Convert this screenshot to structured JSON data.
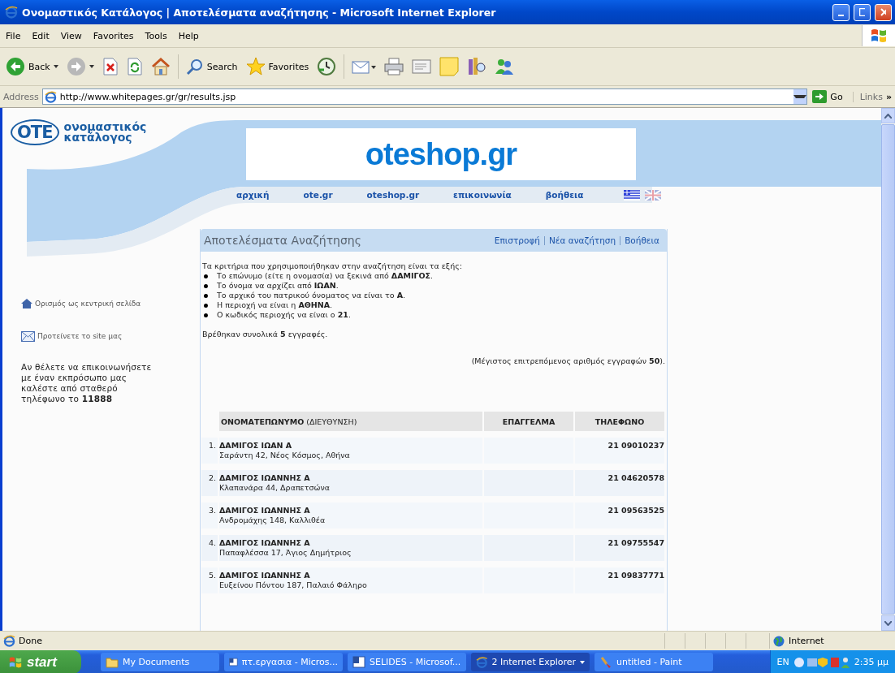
{
  "window": {
    "title": "Ονομαστικός Κατάλογος | Αποτελέσματα αναζήτησης - Microsoft Internet Explorer"
  },
  "menu": [
    "File",
    "Edit",
    "View",
    "Favorites",
    "Tools",
    "Help"
  ],
  "toolbar": [
    {
      "kind": "back",
      "label": "Back"
    },
    {
      "kind": "forward"
    },
    {
      "kind": "stop"
    },
    {
      "kind": "refresh"
    },
    {
      "kind": "home"
    },
    {
      "kind": "search",
      "label": "Search"
    },
    {
      "kind": "favorites",
      "label": "Favorites"
    },
    {
      "kind": "history"
    },
    {
      "kind": "mail"
    },
    {
      "kind": "print"
    },
    {
      "kind": "edit"
    },
    {
      "kind": "notes"
    },
    {
      "kind": "research"
    },
    {
      "kind": "messenger"
    }
  ],
  "address_bar": {
    "label": "Address",
    "value": "http://www.whitepages.gr/gr/results.jsp",
    "go": "Go",
    "links": "Links",
    "more": "»"
  },
  "page": {
    "logo": {
      "mark": "OTE",
      "line_1": "ονομαστικός",
      "line_2": "κατάλογος"
    },
    "banner": "oteshop.gr",
    "nav": [
      "αρχική",
      "ote.gr",
      "oteshop.gr",
      "επικοινωνία",
      "βοήθεια"
    ],
    "sidebar": {
      "links": [
        {
          "kind": "home",
          "label": "Ορισμός ως κεντρική σελίδα"
        },
        {
          "kind": "mail",
          "label": "Προτείνετε το site μας"
        }
      ],
      "contact": "Αν θέλετε να επικοινωνήσετε με έναν εκπρόσωπο μας καλέστε από σταθερό τηλέφωνο το **11888**"
    },
    "results": {
      "title": "Αποτελέσματα Αναζήτησης",
      "links": [
        "Επιστροφή",
        "Νέα αναζήτηση",
        "Βοήθεια"
      ],
      "criteria_intro": "Τα κριτήρια που χρησιμοποιήθηκαν στην αναζήτηση είναι τα εξής:",
      "criteria": [
        "Το επώνυμο (είτε η ονομασία) να ξεκινά από **ΔΑΜΙΓΟΣ**.",
        "Το όνομα να αρχίζει από **ΙΩΑΝ**.",
        "Το αρχικό του πατρικού όνοματος να είναι το **Α**.",
        "Η περιοχή να είναι η **ΑΘΗΝΑ**.",
        "Ο κωδικός περιοχής να είναι ο **21**."
      ],
      "total": "Βρέθηκαν συνολικά **5** εγγραφές.",
      "max_note": "(Μέγιστος επιτρεπόμενος αριθμός εγγραφών **50**).",
      "table": {
        "columns": [
          "**ΟΝΟΜΑΤΕΠΩΝΥΜΟ** (ΔΙΕΥΘΥΝΣΗ)",
          "ΕΠΑΓΓΕΛΜΑ",
          "ΤΗΛΕΦΩΝΟ"
        ],
        "rows": [
          {
            "number": "1.",
            "name": "ΔΑΜΙΓΟΣ ΙΩΑΝ Α",
            "address": "Σαράντη 42, Νέος Κόσμος, Αθήνα",
            "phone": "21 09010237"
          },
          {
            "number": "2.",
            "name": "ΔΑΜΙΓΟΣ ΙΩΑΝΝΗΣ Α",
            "address": "Κλαπανάρα 44, Δραπετσώνα",
            "phone": "21 04620578"
          },
          {
            "number": "3.",
            "name": "ΔΑΜΙΓΟΣ ΙΩΑΝΝΗΣ Α",
            "address": "Ανδρομάχης 148, Καλλιθέα",
            "phone": "21 09563525"
          },
          {
            "number": "4.",
            "name": "ΔΑΜΙΓΟΣ ΙΩΑΝΝΗΣ Α",
            "address": "Παπαφλέσσα 17, Άγιος Δημήτριος",
            "phone": "21 09755547"
          },
          {
            "number": "5.",
            "name": "ΔΑΜΙΓΟΣ ΙΩΑΝΝΗΣ Α",
            "address": "Ευξείνου Πόντου 187, Παλαιό Φάληρο",
            "phone": "21 09837771"
          }
        ]
      }
    }
  },
  "status_bar": {
    "text": "Done",
    "zone": "Internet"
  },
  "taskbar": {
    "start": "start",
    "tasks": [
      {
        "kind": "folder",
        "label": "My Documents",
        "selected": false
      },
      {
        "kind": "word",
        "label": "πτ.εργασια - Micros...",
        "selected": false
      },
      {
        "kind": "word",
        "label": "SELIDES - Microsof...",
        "selected": false
      },
      {
        "kind": "ie_group",
        "label": "2 Internet Explorer",
        "selected": true
      },
      {
        "kind": "paint",
        "label": "untitled - Paint",
        "selected": false
      }
    ],
    "language": "EN",
    "clock": "2:35 μμ"
  }
}
